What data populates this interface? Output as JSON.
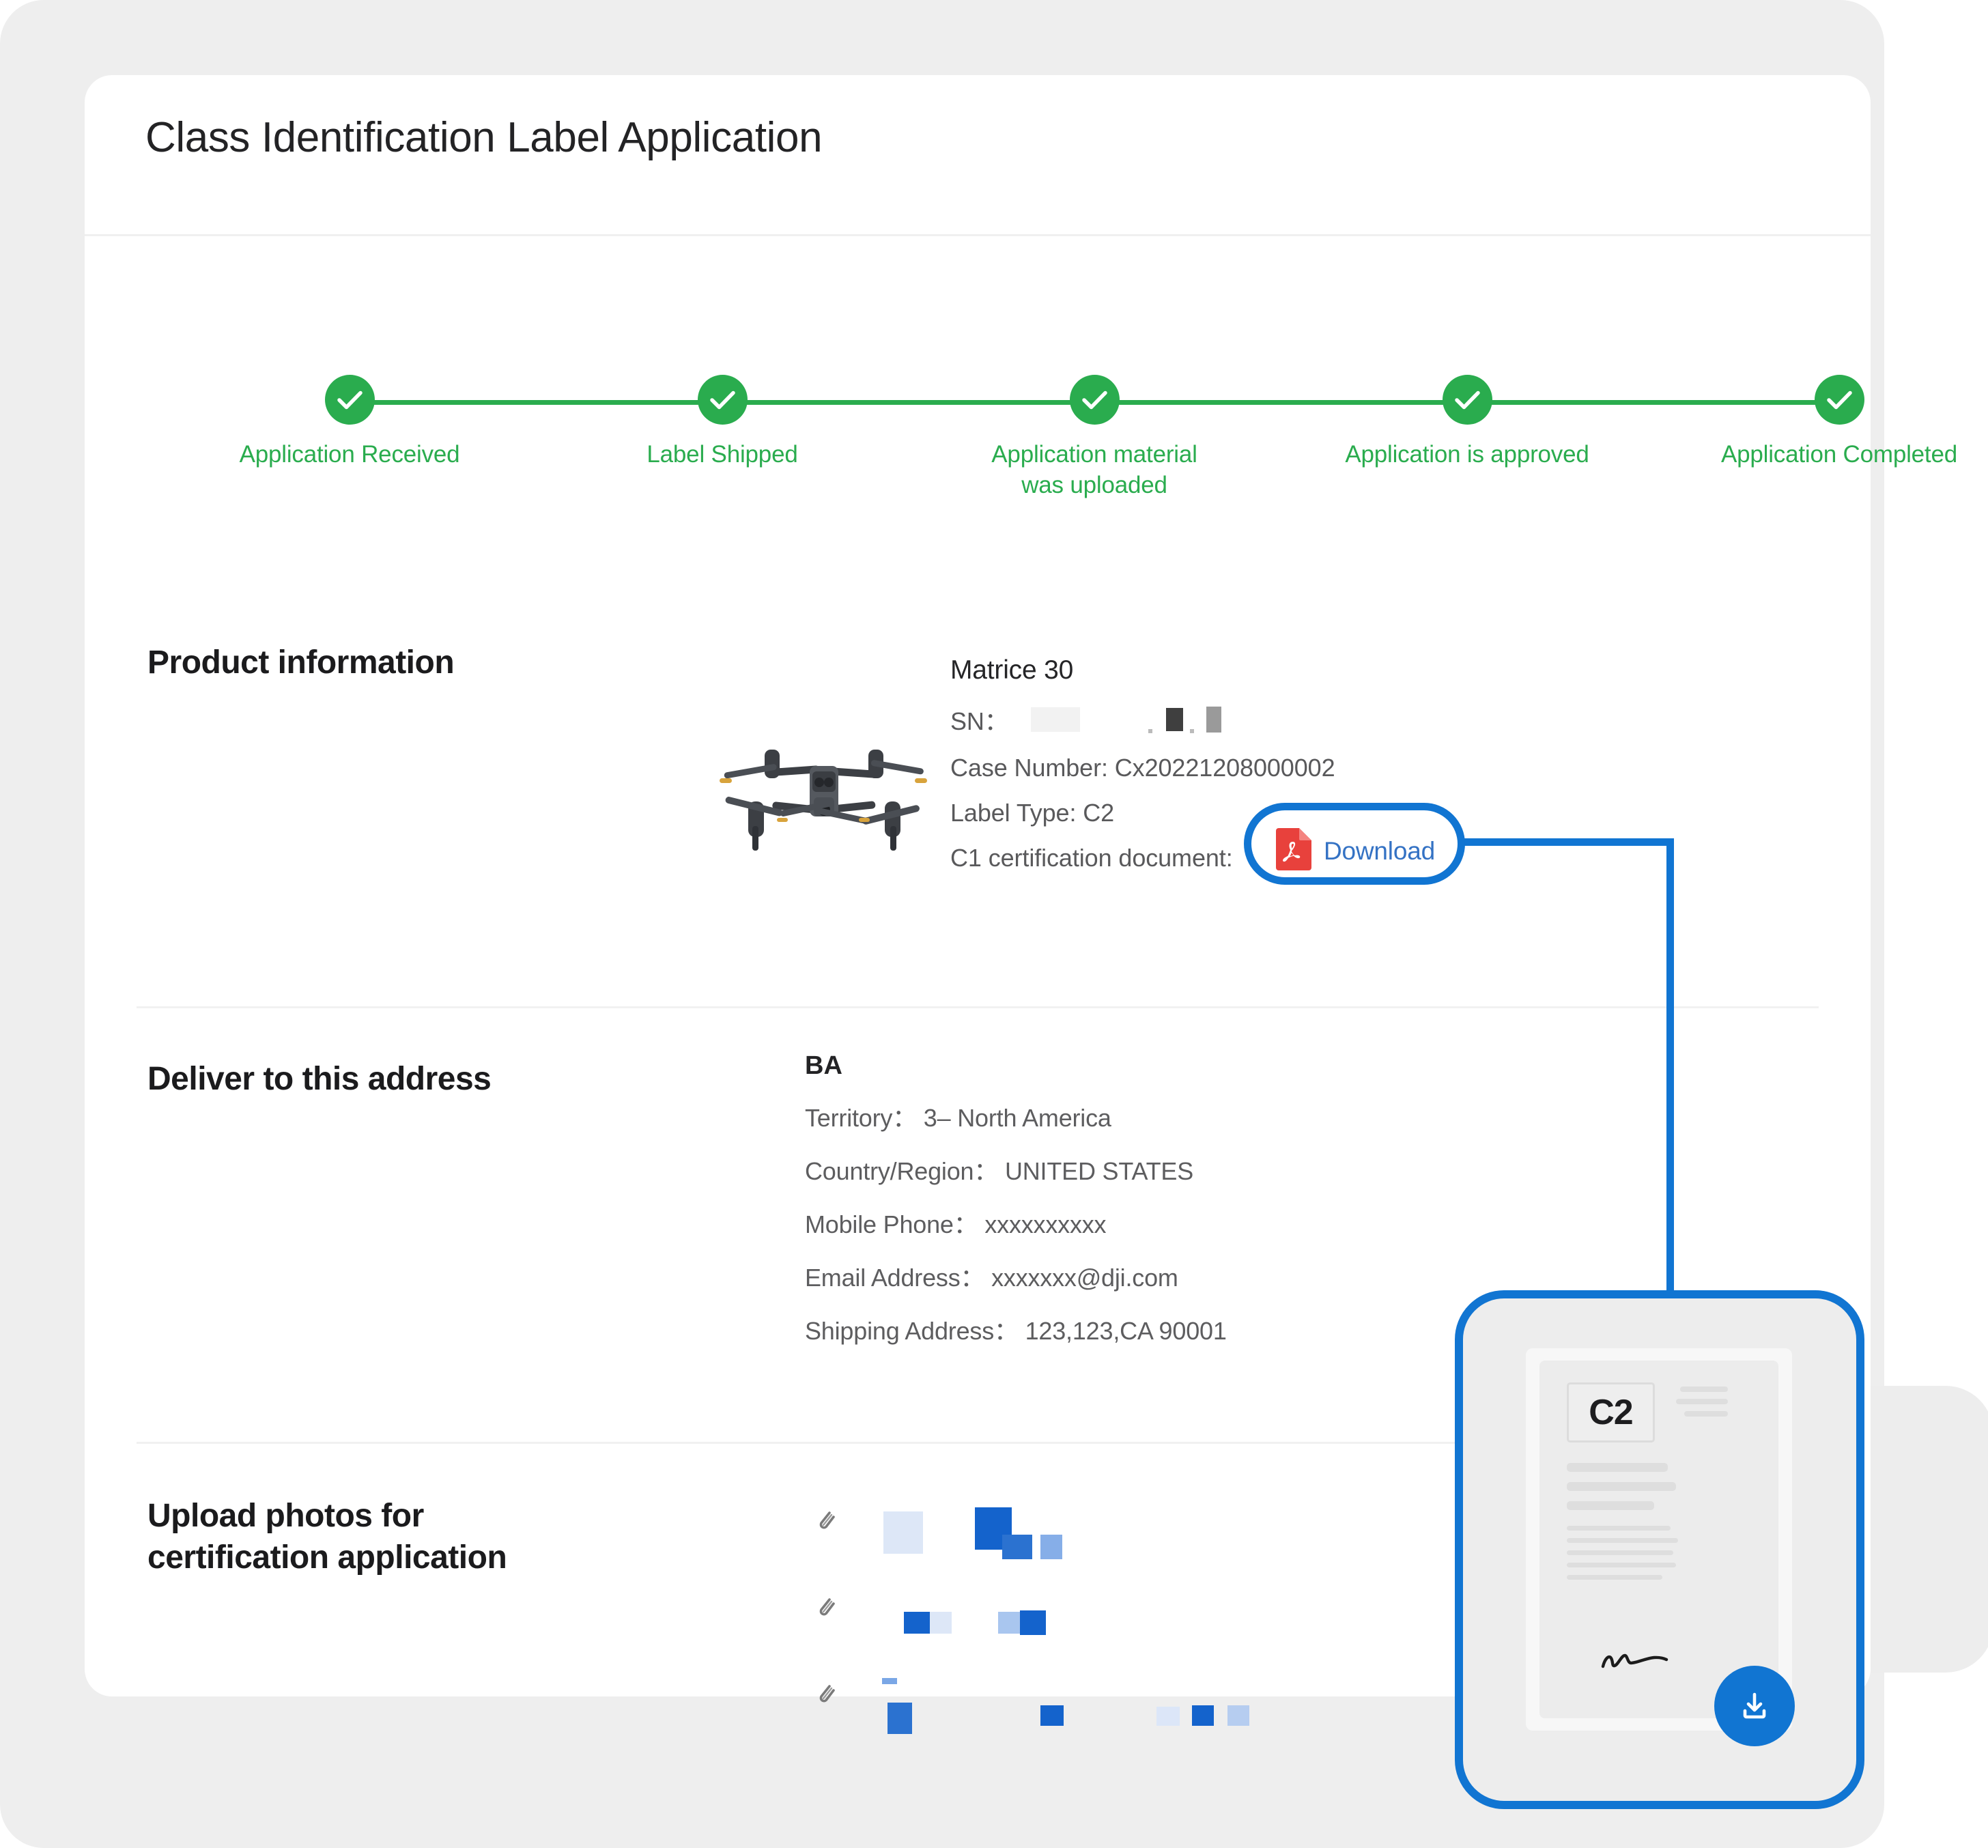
{
  "page": {
    "title": "Class Identification Label Application",
    "accent_green": "#2aac4e",
    "accent_blue": "#1175d2",
    "link_blue": "#3472c4",
    "pdf_red": "#e8413c"
  },
  "stepper": {
    "steps": [
      {
        "label": "Application Received",
        "state": "complete",
        "icon": "check-icon"
      },
      {
        "label": "Label Shipped",
        "state": "complete",
        "icon": "check-icon"
      },
      {
        "label": "Application material was uploaded",
        "state": "complete",
        "icon": "check-icon"
      },
      {
        "label": "Application is approved",
        "state": "complete",
        "icon": "check-icon"
      },
      {
        "label": "Application Completed",
        "state": "complete",
        "icon": "check-icon"
      }
    ]
  },
  "product": {
    "heading": "Product information",
    "image_alt": "drone-product-image",
    "name": "Matrice 30",
    "sn_label": "SN：",
    "sn_value": "",
    "case_number": "Case Number: Cx20221208000002",
    "label_type": "Label Type: C2",
    "cert_doc_label": "C1 certification document:",
    "download_label": "Download",
    "pdf_icon": "pdf-file-icon"
  },
  "address": {
    "heading": "Deliver to this address",
    "name": "BA",
    "rows": [
      "Territory： 3– North America",
      "Country/Region： UNITED STATES",
      "Mobile Phone： xxxxxxxxxx",
      "Email Address： xxxxxxx@dji.com",
      "Shipping Address： 123,123,CA 90001"
    ]
  },
  "upload": {
    "heading": "Upload photos for\ncertification application",
    "attachments": [
      {
        "icon": "paperclip-icon",
        "filename": ""
      },
      {
        "icon": "paperclip-icon",
        "filename": ""
      },
      {
        "icon": "paperclip-icon",
        "filename": ""
      }
    ]
  },
  "callout": {
    "badge_text": "C2",
    "download_icon": "download-icon",
    "signature_alt": "signature-mark"
  }
}
